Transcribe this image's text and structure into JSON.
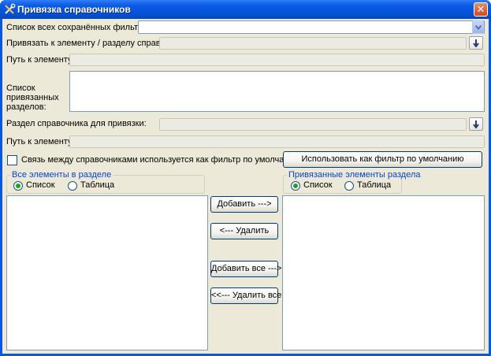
{
  "window": {
    "title": "Привязка справочников"
  },
  "form": {
    "filters_label": "Список всех сохранённых фильтров:",
    "filters_value": "",
    "bind_to_label": "Привязать к элементу / разделу справочника:",
    "bind_to_value": "",
    "path1_label": "Путь к элементу:",
    "path1_value": "",
    "bound_sections_label": "Список привязанных разделов:",
    "section_label": "Раздел справочника для привязки:",
    "section_value": "",
    "path2_label": "Путь к элементу:",
    "path2_value": "",
    "default_filter_checkbox_label": "Связь между справочниками используется как фильтр по умолчанию",
    "default_filter_checked": false,
    "use_as_default_button": "Использовать как фильтр по умолчанию"
  },
  "left_group": {
    "title": "Все элементы в разделе",
    "option_list": "Список",
    "option_table": "Таблица",
    "selected": "Список"
  },
  "right_group": {
    "title": "Привязанные элементы раздела",
    "option_list": "Список",
    "option_table": "Таблица",
    "selected": "Список"
  },
  "transfer_buttons": {
    "add": "Добавить --->",
    "remove": "<--- Удалить",
    "add_all": "Добавить все --->>",
    "remove_all": "<<--- Удалить все"
  },
  "colors": {
    "title_bar": "#0553d8",
    "client_bg": "#ece9d8",
    "group_title": "#0046d5",
    "close_button": "#d3491c"
  }
}
